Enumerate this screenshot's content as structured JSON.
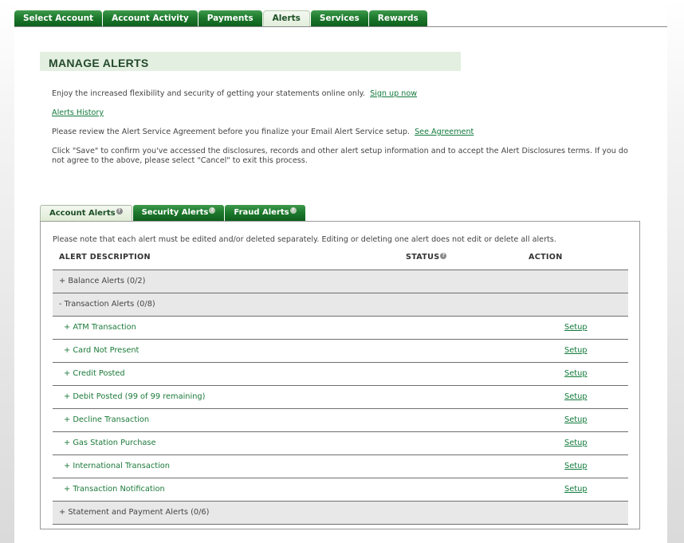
{
  "topnav": {
    "tabs": [
      {
        "label": "Select Account",
        "active": false
      },
      {
        "label": "Account Activity",
        "active": false
      },
      {
        "label": "Payments",
        "active": false
      },
      {
        "label": "Alerts",
        "active": true
      },
      {
        "label": "Services",
        "active": false
      },
      {
        "label": "Rewards",
        "active": false
      }
    ]
  },
  "header": {
    "title": "MANAGE ALERTS"
  },
  "intro": {
    "line1_text": "Enjoy the increased flexibility and security of getting your statements online only.",
    "line1_link": "Sign up now",
    "alerts_history_link": "Alerts History",
    "line3_text": "Please review the Alert Service Agreement before you finalize your Email Alert Service setup.",
    "line3_link": "See Agreement",
    "line4_text": "Click \"Save\" to confirm you've accessed the disclosures, records and other alert setup information and to accept the Alert Disclosures terms. If you do not agree to the above, please select \"Cancel\" to exit this process."
  },
  "subtabs": [
    {
      "label": "Account Alerts",
      "active": true,
      "help_icon": "question-circle-icon"
    },
    {
      "label": "Security Alerts",
      "active": false,
      "help_icon": "question-circle-icon"
    },
    {
      "label": "Fraud Alerts",
      "active": false,
      "help_icon": "question-circle-icon"
    }
  ],
  "panel": {
    "note": "Please note that each alert must be edited and/or deleted separately. Editing or deleting one alert does not edit or delete all alerts.",
    "columns": {
      "description": "ALERT DESCRIPTION",
      "status": "STATUS",
      "action": "ACTION"
    },
    "rows": [
      {
        "type": "group",
        "label": "+ Balance Alerts (0/2)"
      },
      {
        "type": "group",
        "label": "- Transaction Alerts (0/8)"
      },
      {
        "type": "item",
        "label": "+ ATM Transaction",
        "action": "Setup"
      },
      {
        "type": "item",
        "label": "+ Card Not Present",
        "action": "Setup"
      },
      {
        "type": "item",
        "label": "+ Credit Posted",
        "action": "Setup"
      },
      {
        "type": "item",
        "label": "+ Debit Posted (99 of 99 remaining)",
        "action": "Setup"
      },
      {
        "type": "item",
        "label": "+ Decline Transaction",
        "action": "Setup"
      },
      {
        "type": "item",
        "label": "+ Gas Station Purchase",
        "action": "Setup"
      },
      {
        "type": "item",
        "label": "+ International Transaction",
        "action": "Setup"
      },
      {
        "type": "item",
        "label": "+ Transaction Notification",
        "action": "Setup"
      },
      {
        "type": "group",
        "label": "+ Statement and Payment Alerts (0/6)"
      }
    ]
  },
  "colors": {
    "brand_green": "#1e7a2e",
    "link_green": "#117a3c",
    "header_bg": "#e3efe0"
  }
}
